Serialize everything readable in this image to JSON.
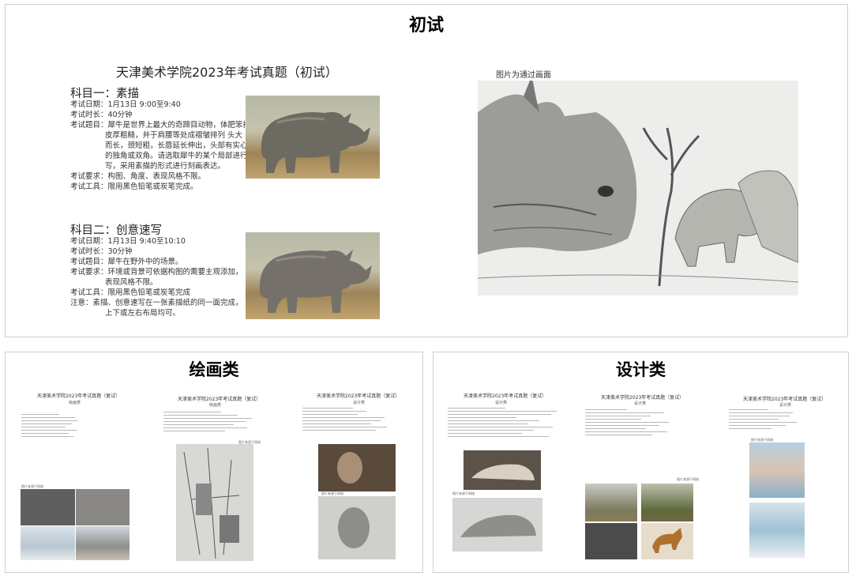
{
  "sections": {
    "top_title": "初试",
    "paint_title": "绘画类",
    "design_title": "设计类"
  },
  "exam": {
    "doc_title": "天津美术学院2023年考试真题（初试）",
    "subject1": {
      "heading": "科目一：素描",
      "lines": [
        "考试日期：1月13日 9:00至9:40",
        "考试时长：40分钟",
        "考试题目：犀牛是世界上最大的奇蹄目动物，体肥笨拙，",
        "皮厚粗糙，并于肩腰等处成褶皱排列     头大",
        "而长，颈短粗，长唇延长伸出，头部有实心",
        "的独角或双角。请选取犀牛的某个局部进行默",
        "写，采用素描的形式进行刻画表达。",
        "考试要求：构图、角度、表现风格不限。",
        "考试工具：限用黑色铅笔或炭笔完成。"
      ]
    },
    "subject2": {
      "heading": "科目二：创意速写",
      "lines": [
        "考试日期：1月13日 9:40至10:10",
        "考试时长：30分钟",
        "考试题目：犀牛在野外中的场景。",
        "考试要求：环境或背景可依据构图的需要主观添加，",
        "表现风格不限。",
        "考试工具：限用黑色铅笔或炭笔完成",
        "注意：素描、创意速写在一张素描纸的同一面完成，",
        "上下或左右布局均可。"
      ]
    },
    "image_caption": "图片为通过画面"
  },
  "paint_docs": [
    {
      "title": "天津美术学院2023年考试真题（复试）",
      "sub": "绘画类"
    },
    {
      "title": "天津美术学院2023年考试真题（复试）",
      "sub": "绘画类"
    },
    {
      "title": "天津美术学院2023年考试真题（复试）",
      "sub": "设计类"
    }
  ],
  "design_docs": [
    {
      "title": "天津美术学院2023年考试真题（复试）",
      "sub": "设计类"
    },
    {
      "title": "天津美术学院2023年考试真题（复试）",
      "sub": "设计类"
    },
    {
      "title": "天津美术学院2023年考试真题（复试）",
      "sub": "设计类"
    }
  ],
  "mini_captions": [
    "图片来源于网络",
    "图片来源于网络",
    "图片来源于网络",
    "图片来源于网络",
    "图片来源于网络",
    "图片来源于网络"
  ]
}
